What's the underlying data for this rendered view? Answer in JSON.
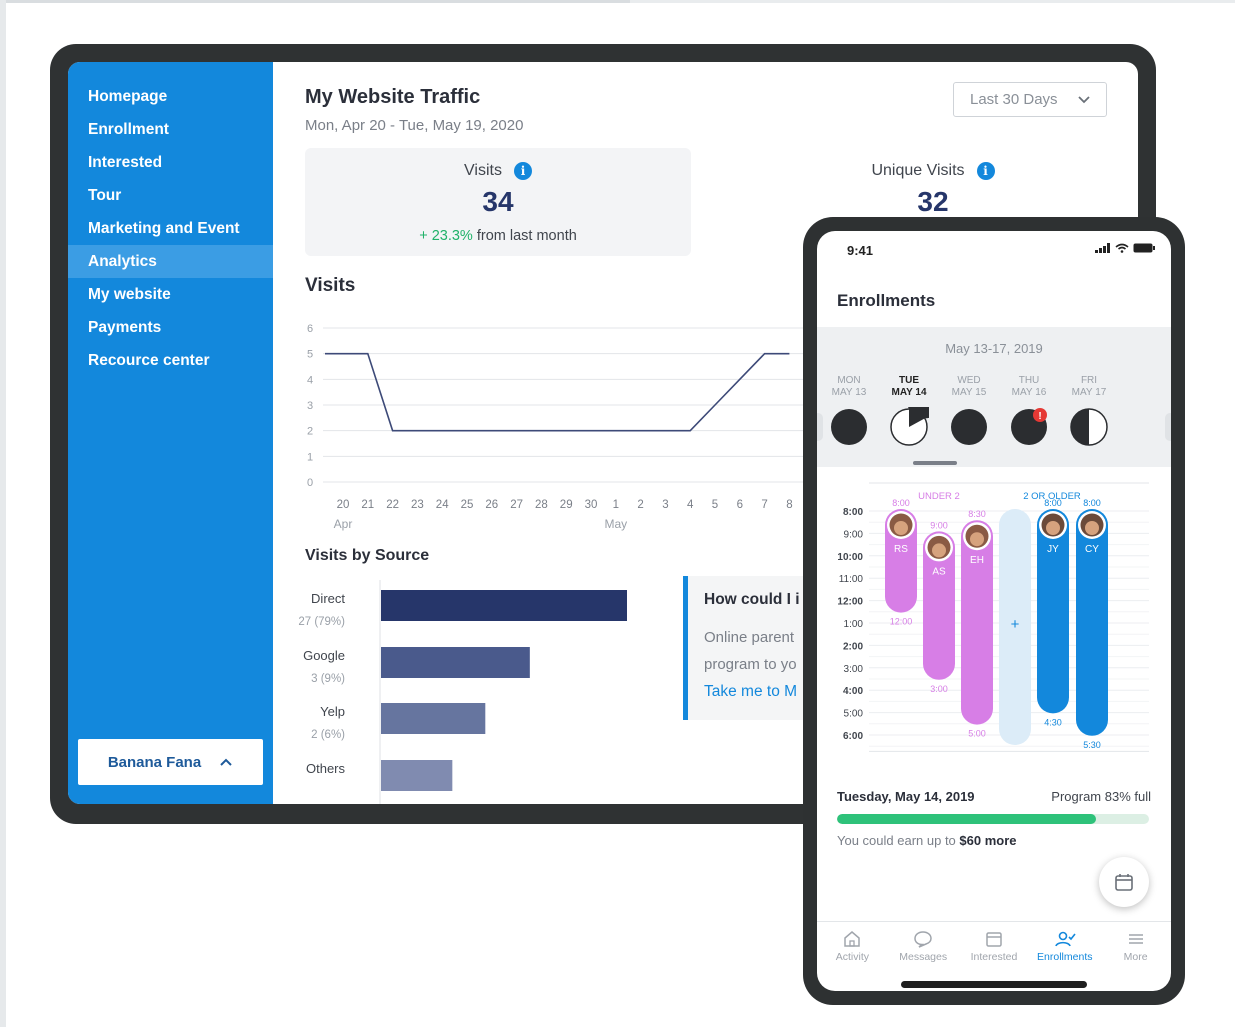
{
  "dashboard": {
    "nav": [
      {
        "label": "Homepage",
        "active": false
      },
      {
        "label": "Enrollment",
        "active": false
      },
      {
        "label": "Interested",
        "active": false
      },
      {
        "label": "Tour",
        "active": false
      },
      {
        "label": "Marketing and Event",
        "active": false
      },
      {
        "label": "Analytics",
        "active": true
      },
      {
        "label": "My website",
        "active": false
      },
      {
        "label": "Payments",
        "active": false
      },
      {
        "label": "Recource center",
        "active": false
      }
    ],
    "account_label": "Banana Fana",
    "title": "My Website Traffic",
    "date_range": "Mon, Apr 20 - Tue, May 19, 2020",
    "range_select": "Last 30 Days",
    "visits": {
      "label": "Visits",
      "value": "34",
      "change": "+ 23.3%",
      "change_suffix": "from last month"
    },
    "unique_visits": {
      "label": "Unique Visits",
      "value": "32"
    },
    "visits_chart_title": "Visits",
    "sources_title": "Visits by Source",
    "callout": {
      "title": "How could I i",
      "text_line1": "Online parent",
      "text_line2": "program to yo",
      "link": "Take me to M"
    },
    "colors": {
      "brand_blue": "#1388dc",
      "navy": "#26366a",
      "green": "#21b26a"
    }
  },
  "chart_data": [
    {
      "type": "line",
      "title": "Visits",
      "x": [
        "20",
        "21",
        "22",
        "23",
        "24",
        "25",
        "26",
        "27",
        "28",
        "29",
        "30",
        "1",
        "2",
        "3",
        "4",
        "5",
        "6",
        "7",
        "8"
      ],
      "month_labels": [
        "Apr",
        "May"
      ],
      "series": [
        {
          "values": [
            5,
            5,
            2,
            2,
            2,
            2,
            2,
            2,
            2,
            2,
            2,
            2,
            2,
            2,
            2,
            3,
            4,
            5,
            5
          ]
        }
      ],
      "ylim": [
        0,
        6
      ],
      "yticks": [
        0,
        1,
        2,
        3,
        4,
        5,
        6
      ],
      "grid": true
    },
    {
      "type": "bar",
      "title": "Visits by Source",
      "orientation": "horizontal",
      "categories": [
        "Direct",
        "Google",
        "Yelp",
        "Others"
      ],
      "values": [
        27,
        3,
        2,
        1
      ],
      "value_labels": [
        "27 (79%)",
        "3 (9%)",
        "2 (6%)",
        ""
      ],
      "bar_colors": [
        "#26366a",
        "#4a5a8c",
        "#66759f",
        "#808bb0"
      ]
    }
  ],
  "phone": {
    "status_time": "9:41",
    "title": "Enrollments",
    "week_range": "May 13-17, 2019",
    "days": [
      {
        "dow": "MON",
        "date": "MAY 13",
        "selected": false,
        "fill": 1.0,
        "alert": false
      },
      {
        "dow": "TUE",
        "date": "MAY 14",
        "selected": true,
        "fill": 0.83,
        "alert": false
      },
      {
        "dow": "WED",
        "date": "MAY 15",
        "selected": false,
        "fill": 1.0,
        "alert": false
      },
      {
        "dow": "THU",
        "date": "MAY 16",
        "selected": false,
        "fill": 1.0,
        "alert": true
      },
      {
        "dow": "FRI",
        "date": "MAY 17",
        "selected": false,
        "fill": 0.5,
        "alert": false
      }
    ],
    "group_labels": [
      "UNDER 2",
      "2 OR OLDER"
    ],
    "times": [
      "8:00",
      "9:00",
      "10:00",
      "11:00",
      "12:00",
      "1:00",
      "2:00",
      "3:00",
      "4:00",
      "5:00",
      "6:00"
    ],
    "children": [
      {
        "initials": "RS",
        "group": "under2",
        "start_label": "8:00",
        "end_label": "12:00",
        "start": 8.0,
        "end": 12.0
      },
      {
        "initials": "AS",
        "group": "under2",
        "start_label": "9:00",
        "end_label": "3:00",
        "start": 9.0,
        "end": 15.0
      },
      {
        "initials": "EH",
        "group": "under2",
        "start_label": "8:30",
        "end_label": "5:00",
        "start": 8.5,
        "end": 17.0
      },
      {
        "initials": "JY",
        "group": "older",
        "start_label": "8:00",
        "end_label": "4:30",
        "start": 8.0,
        "end": 16.5
      },
      {
        "initials": "CY",
        "group": "older",
        "start_label": "8:00",
        "end_label": "5:30",
        "start": 8.0,
        "end": 17.5
      }
    ],
    "program_date": "Tuesday, May 14, 2019",
    "program_full": "Program 83% full",
    "program_fill": 0.83,
    "earn_prefix": "You could earn up to",
    "earn_amount": "$60 more",
    "tabs": [
      {
        "label": "Activity",
        "icon": "home-icon",
        "active": false
      },
      {
        "label": "Messages",
        "icon": "chat-icon",
        "active": false
      },
      {
        "label": "Interested",
        "icon": "calendar-icon",
        "active": false
      },
      {
        "label": "Enrollments",
        "icon": "user-check-icon",
        "active": true
      },
      {
        "label": "More",
        "icon": "menu-icon",
        "active": false
      }
    ],
    "colors": {
      "under2": "#d77ee6",
      "older": "#1388dc",
      "progress": "#2ec27a"
    }
  }
}
